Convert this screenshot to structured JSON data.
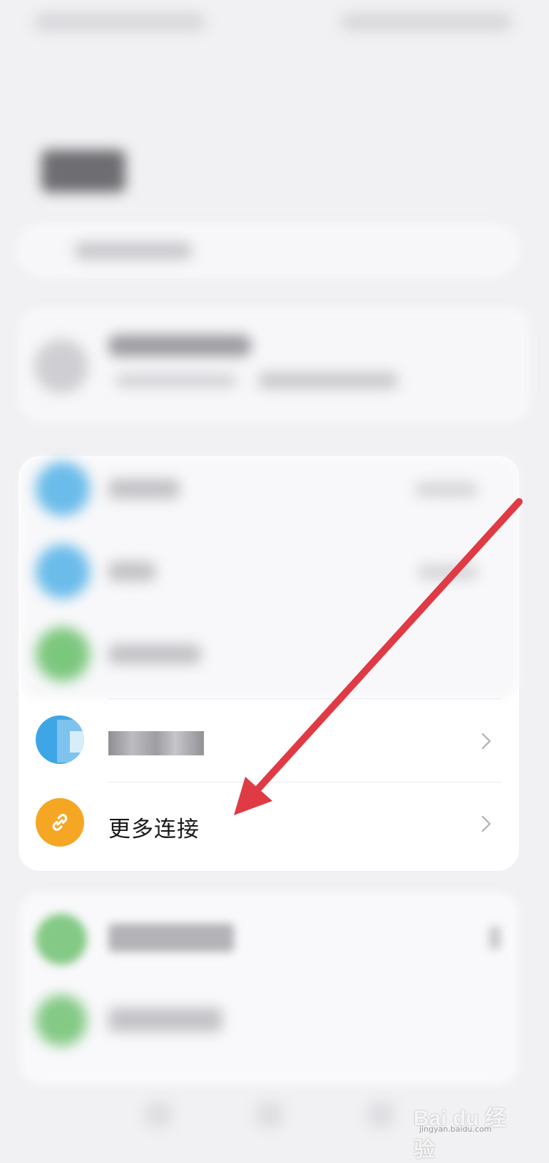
{
  "connections": {
    "more_connections": {
      "label": "更多连接",
      "icon": "link-icon"
    },
    "obscured_item": {
      "icon": "mosaic-icon"
    }
  },
  "colors": {
    "link_icon_bg": "#f5a623",
    "annotation_arrow": "#e03a45"
  },
  "watermark": {
    "brand": "Bai du 经验",
    "domain": "jingyan.baidu.com"
  }
}
